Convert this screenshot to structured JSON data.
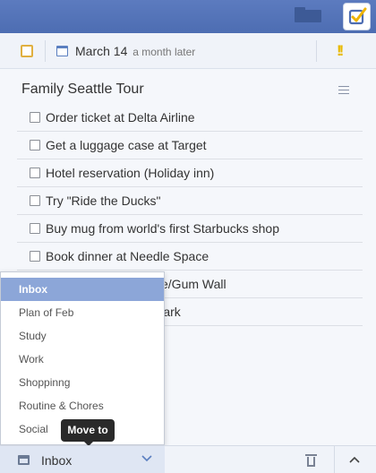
{
  "header": {
    "folder_icon": "folder-icon",
    "app_icon": "checkmark-app-icon"
  },
  "datebar": {
    "date": "March 14",
    "relative": "a month later",
    "priority_mark": "!!"
  },
  "list": {
    "title": "Family Seattle Tour",
    "tasks": [
      "Order ticket at Delta Airline",
      "Get a luggage case at Target",
      "Hotel reservation (Holiday inn)",
      "Try \"Ride the Ducks\"",
      "Buy mug from world's first Starbucks shop",
      "Book dinner at Needle Space",
      "ce/Gum Wall",
      "Park"
    ]
  },
  "dropdown": {
    "items": [
      "Inbox",
      "Plan of Feb",
      "Study",
      "Work",
      "Shoppinng",
      "Routine & Chores",
      "Social"
    ],
    "selected": "Inbox"
  },
  "tooltip": {
    "text": "Move to"
  },
  "bottombar": {
    "list_label": "Inbox"
  },
  "colors": {
    "header": "#5274b8",
    "accent": "#5b7fc0",
    "priority": "#e8b900",
    "selected_item": "#8ca6d8"
  }
}
